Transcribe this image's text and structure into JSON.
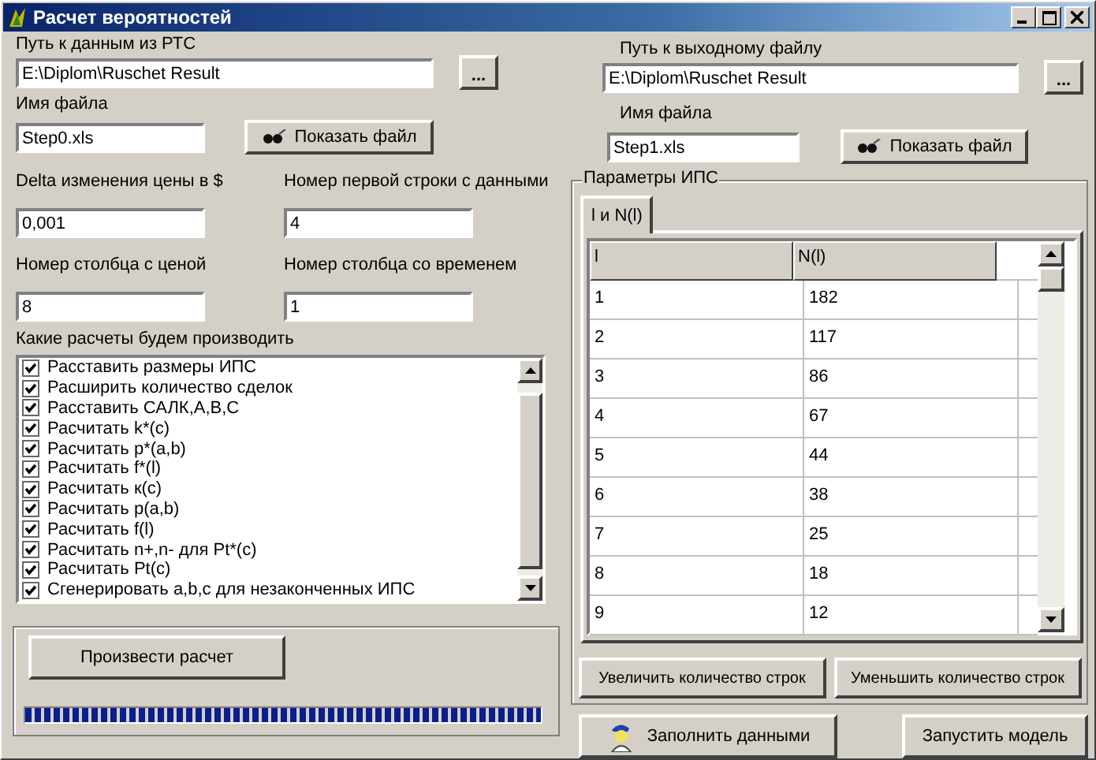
{
  "window": {
    "title": "Расчет вероятностей"
  },
  "input": {
    "path_label": "Путь к данным из РТС",
    "path": "E:\\Diplom\\Ruschet Result",
    "browse": "...",
    "file_label": "Имя файла",
    "file": "Step0.xls",
    "show_button": "Показать файл"
  },
  "params": [
    {
      "label": "Delta изменения цены в $",
      "value": "0,001"
    },
    {
      "label": "Номер первой строки с данными",
      "value": "4"
    },
    {
      "label": "Номер столбца с ценой",
      "value": "8"
    },
    {
      "label": "Номер столбца со временем",
      "value": "1"
    }
  ],
  "calculations": {
    "label": "Какие расчеты будем производить",
    "items": [
      {
        "label": "Расставить размеры ИПС",
        "checked": true
      },
      {
        "label": "Расширить количество сделок",
        "checked": true
      },
      {
        "label": "Расставить САЛК,A,B,C",
        "checked": true
      },
      {
        "label": "Расчитать k*(c)",
        "checked": true
      },
      {
        "label": "Расчитать p*(a,b)",
        "checked": true
      },
      {
        "label": "Расчитать f*(l)",
        "checked": true
      },
      {
        "label": "Расчитать к(c)",
        "checked": true
      },
      {
        "label": "Расчитать p(a,b)",
        "checked": true
      },
      {
        "label": "Расчитать f(l)",
        "checked": true
      },
      {
        "label": "Расчитать n+,n- для Pt*(c)",
        "checked": true
      },
      {
        "label": "Расчитать Pt(c)",
        "checked": true
      },
      {
        "label": "Сгенерировать a,b,c для незаконченных ИПС",
        "checked": true
      }
    ]
  },
  "run_group": {
    "button": "Произвести расчет",
    "progress": {
      "level": 1
    }
  },
  "output": {
    "path_label": "Путь к выходному файлу",
    "path": "E:\\Diplom\\Ruschet Result",
    "browse": "...",
    "file_label": "Имя файла",
    "file": "Step1.xls",
    "show_button": "Показать файл"
  },
  "ips_group": {
    "title": "Параметры ИПС",
    "tabs": [
      {
        "label": "l и N(l)",
        "selected": true
      }
    ],
    "table": {
      "columns": [
        "l",
        "N(l)"
      ],
      "rows": [
        [
          "1",
          "182"
        ],
        [
          "2",
          "117"
        ],
        [
          "3",
          "86"
        ],
        [
          "4",
          "67"
        ],
        [
          "5",
          "44"
        ],
        [
          "6",
          "38"
        ],
        [
          "7",
          "25"
        ],
        [
          "8",
          "18"
        ],
        [
          "9",
          "12"
        ]
      ]
    },
    "buttons": [
      "Увеличить количество строк",
      "Уменьшить количество строк"
    ]
  },
  "bottom_buttons": [
    {
      "label": "Заполнить данными",
      "kind": "fill"
    },
    {
      "label": "Запустить модель",
      "kind": "plain"
    }
  ]
}
